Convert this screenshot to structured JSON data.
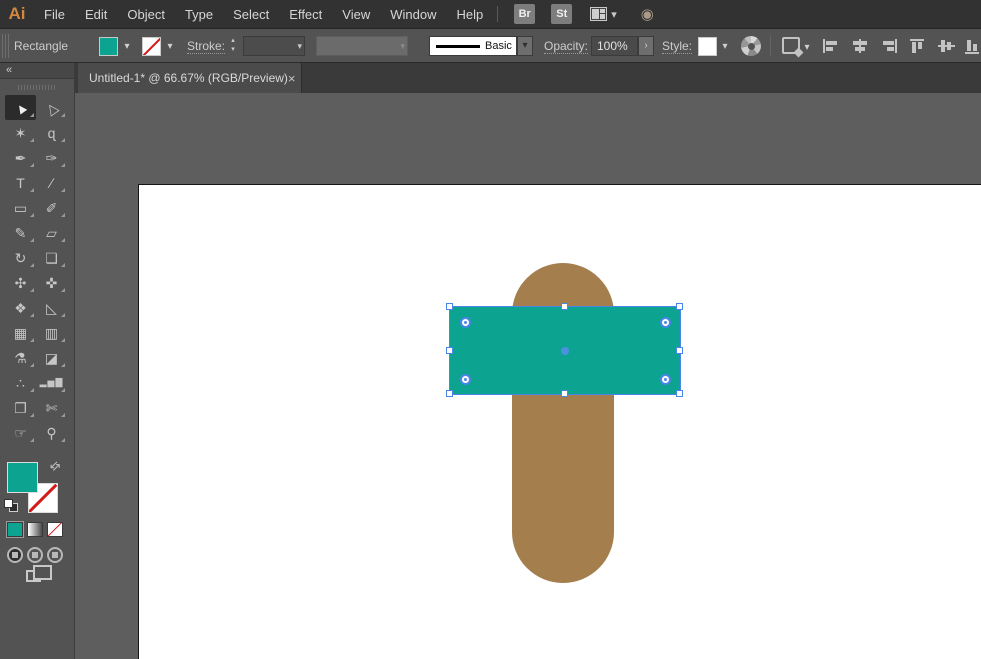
{
  "colors": {
    "teal": "#0CA390",
    "brown": "#A57E4E",
    "selection_blue": "#4A86E8",
    "logo_orange": "#D4873F"
  },
  "icons": {
    "chevron_down": "▾",
    "chevron_up": "▴",
    "collapse_left": "«",
    "close": "×",
    "swap": "⇆",
    "arrow_right": "›",
    "gpu": "◉"
  },
  "menubar": {
    "logo": "Ai",
    "items": [
      "File",
      "Edit",
      "Object",
      "Type",
      "Select",
      "Effect",
      "View",
      "Window",
      "Help"
    ],
    "bridge_button": "Br",
    "stock_button": "St"
  },
  "controlbar": {
    "selection_type": "Rectangle",
    "stroke_label": "Stroke:",
    "brush_name": "Basic",
    "opacity_label": "Opacity:",
    "opacity_value": "100%",
    "style_label": "Style:"
  },
  "document_tab": {
    "title": "Untitled-1* @ 66.67% (RGB/Preview)"
  },
  "tools": [
    {
      "name": "selection",
      "glyph": "▲",
      "active": true
    },
    {
      "name": "direct-selection",
      "glyph": "△"
    },
    {
      "name": "magic-wand",
      "glyph": "✶"
    },
    {
      "name": "lasso",
      "glyph": "ɋ"
    },
    {
      "name": "pen",
      "glyph": "✒"
    },
    {
      "name": "curvature",
      "glyph": "✑"
    },
    {
      "name": "type",
      "glyph": "T"
    },
    {
      "name": "line-segment",
      "glyph": "∕"
    },
    {
      "name": "rectangle",
      "glyph": "▭"
    },
    {
      "name": "paintbrush",
      "glyph": "✐"
    },
    {
      "name": "shaper",
      "glyph": "✎"
    },
    {
      "name": "eraser",
      "glyph": "▱"
    },
    {
      "name": "rotate",
      "glyph": "↻"
    },
    {
      "name": "scale",
      "glyph": "❏"
    },
    {
      "name": "width",
      "glyph": "✣"
    },
    {
      "name": "puppet-warp",
      "glyph": "✜"
    },
    {
      "name": "shape-builder",
      "glyph": "❖"
    },
    {
      "name": "perspective-grid",
      "glyph": "◺"
    },
    {
      "name": "mesh",
      "glyph": "▦"
    },
    {
      "name": "gradient",
      "glyph": "▥"
    },
    {
      "name": "eyedropper",
      "glyph": "⚗"
    },
    {
      "name": "blend",
      "glyph": "◪"
    },
    {
      "name": "symbol-sprayer",
      "glyph": "∴"
    },
    {
      "name": "column-graph",
      "glyph": "▂▅▇"
    },
    {
      "name": "artboard",
      "glyph": "❐"
    },
    {
      "name": "slice",
      "glyph": "✄"
    },
    {
      "name": "hand",
      "glyph": "☞"
    },
    {
      "name": "zoom",
      "glyph": "⚲"
    }
  ],
  "artwork": {
    "shapes": [
      {
        "name": "rounded-rectangle-vertical",
        "fill": "#A57E4E"
      },
      {
        "name": "rectangle-selected",
        "fill": "#0CA390",
        "selected": true
      }
    ]
  }
}
